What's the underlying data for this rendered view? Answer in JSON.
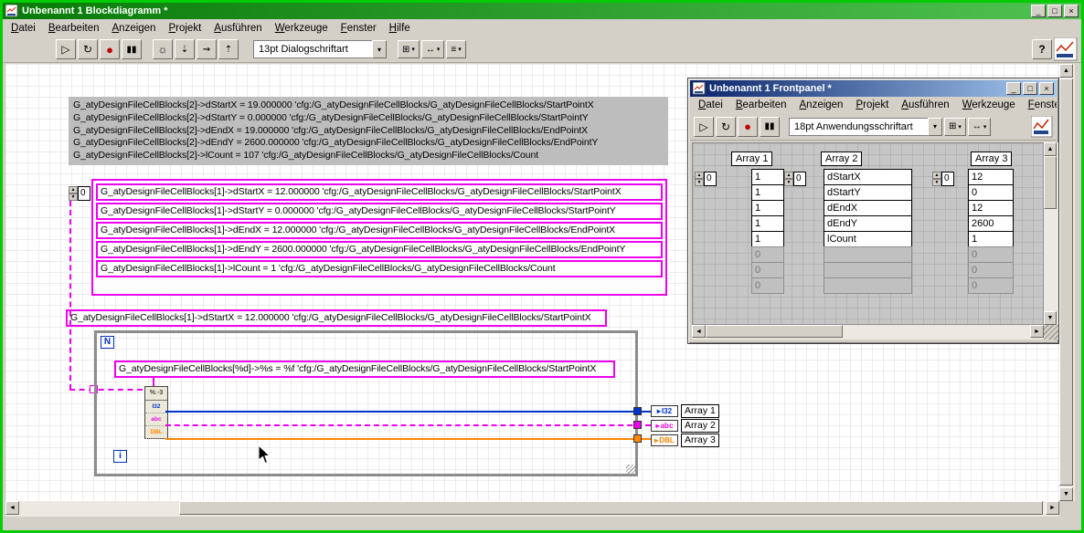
{
  "bd": {
    "title": "Unbenannt 1 Blockdiagramm *",
    "menu": [
      "Datei",
      "Bearbeiten",
      "Anzeigen",
      "Projekt",
      "Ausführen",
      "Werkzeuge",
      "Fenster",
      "Hilfe"
    ],
    "toolbar": {
      "font": "13pt Dialogschriftart"
    },
    "comment_lines": [
      "G_atyDesignFileCellBlocks[2]->dStartX = 19.000000 'cfg:/G_atyDesignFileCellBlocks/G_atyDesignFileCellBlocks/StartPointX",
      "G_atyDesignFileCellBlocks[2]->dStartY = 0.000000 'cfg:/G_atyDesignFileCellBlocks/G_atyDesignFileCellBlocks/StartPointY",
      "G_atyDesignFileCellBlocks[2]->dEndX = 19.000000 'cfg:/G_atyDesignFileCellBlocks/G_atyDesignFileCellBlocks/EndPointX",
      "G_atyDesignFileCellBlocks[2]->dEndY = 2600.000000 'cfg:/G_atyDesignFileCellBlocks/G_atyDesignFileCellBlocks/EndPointY",
      "G_atyDesignFileCellBlocks[2]->lCount = 107 'cfg:/G_atyDesignFileCellBlocks/G_atyDesignFileCellBlocks/Count"
    ],
    "index_constant": "0",
    "pink_lines": [
      "G_atyDesignFileCellBlocks[1]->dStartX = 12.000000 'cfg:/G_atyDesignFileCellBlocks/G_atyDesignFileCellBlocks/StartPointX",
      "G_atyDesignFileCellBlocks[1]->dStartY = 0.000000 'cfg:/G_atyDesignFileCellBlocks/G_atyDesignFileCellBlocks/StartPointY",
      "G_atyDesignFileCellBlocks[1]->dEndX = 12.000000 'cfg:/G_atyDesignFileCellBlocks/G_atyDesignFileCellBlocks/EndPointX",
      "G_atyDesignFileCellBlocks[1]->dEndY = 2600.000000 'cfg:/G_atyDesignFileCellBlocks/G_atyDesignFileCellBlocks/EndPointY",
      "G_atyDesignFileCellBlocks[1]->lCount = 1 'cfg:/G_atyDesignFileCellBlocks/G_atyDesignFileCellBlocks/Count"
    ],
    "single_line": "G_atyDesignFileCellBlocks[1]->dStartX = 12.000000 'cfg:/G_atyDesignFileCellBlocks/G_atyDesignFileCellBlocks/StartPointX",
    "loop": {
      "n": "N",
      "i": "i",
      "format_line": "G_atyDesignFileCellBlocks[%d]->%s = %f 'cfg:/G_atyDesignFileCellBlocks/G_atyDesignFileCellBlocks/StartPointX"
    },
    "node": {
      "header": "%.-3",
      "rows": [
        "I32",
        "abc",
        "DBL"
      ]
    },
    "terminals": [
      {
        "type": "I32",
        "label": "Array 1"
      },
      {
        "type": "abc",
        "label": "Array 2"
      },
      {
        "type": "DBL",
        "label": "Array 3"
      }
    ]
  },
  "fp": {
    "title": "Unbenannt 1 Frontpanel *",
    "menu": [
      "Datei",
      "Bearbeiten",
      "Anzeigen",
      "Projekt",
      "Ausführen",
      "Werkzeuge",
      "Fenster"
    ],
    "toolbar": {
      "font": "18pt Anwendungsschriftart"
    },
    "arrays": [
      {
        "label": "Array 1",
        "index": "0",
        "values": [
          "1",
          "1",
          "1",
          "1",
          "1"
        ],
        "dimmed": [
          "0",
          "0",
          "0"
        ]
      },
      {
        "label": "Array 2",
        "index": "0",
        "values": [
          "dStartX",
          "dStartY",
          "dEndX",
          "dEndY",
          "lCount"
        ],
        "dimmed": [
          "",
          "",
          ""
        ]
      },
      {
        "label": "Array 3",
        "index": "0",
        "values": [
          "12",
          "0",
          "12",
          "2600",
          "1"
        ],
        "dimmed": [
          "0",
          "0",
          "0"
        ]
      }
    ]
  },
  "colors": {
    "wire_string": "#f000f0",
    "wire_i32": "#0033cc",
    "wire_dbl": "#ff8800",
    "bd_title": "#0b7d0b",
    "fp_title": "#0a246a"
  },
  "icons": {
    "run": "▷",
    "run_continuous": "↻",
    "abort": "●",
    "pause": "▮▮",
    "highlight": "☼",
    "step_into": "⇣",
    "step_over": "⇝",
    "step_out": "⇡",
    "dropdown": "▾",
    "minimize": "_",
    "maximize": "□",
    "close": "×",
    "help": "?",
    "scroll_up": "▲",
    "scroll_down": "▼",
    "scroll_left": "◄",
    "scroll_right": "►",
    "spin_up": "▲",
    "spin_down": "▼",
    "align": "⊞",
    "distribute": "↔",
    "reorder": "≡",
    "terminal_arrow": "▸"
  }
}
